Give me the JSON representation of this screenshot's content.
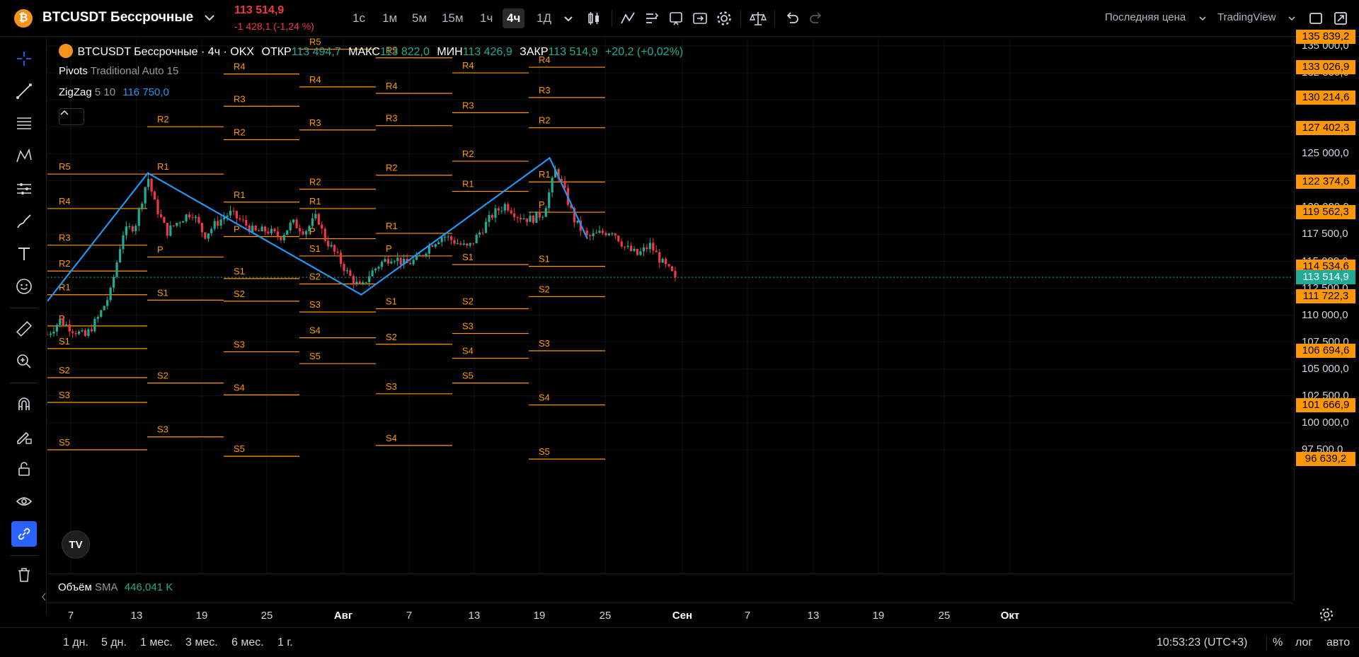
{
  "header": {
    "coin_glyph": "₿",
    "symbol": "BTCUSDT Бессрочные",
    "price": "113 514,9",
    "change": "-1 428,1 (-1,24 %)",
    "timeframes": [
      "1с",
      "1м",
      "5м",
      "15м",
      "1ч",
      "4ч",
      "1Д"
    ],
    "active_timeframe": "4ч",
    "price_type": "Последняя цена",
    "chart_source": "TradingView"
  },
  "legend": {
    "title": "BTCUSDT Бессрочные · 4ч · OKX",
    "open_label": "ОТКР",
    "open": "113 494,7",
    "high_label": "МАКС",
    "high": "113 822,0",
    "low_label": "МИН",
    "low": "113 426,9",
    "close_label": "ЗАКР",
    "close": "113 514,9",
    "change": "+20,2 (+0,02%)",
    "pivots_name": "Pivots",
    "pivots_params": "Traditional Auto 15",
    "zigzag_name": "ZigZag",
    "zigzag_params": "5 10",
    "zigzag_value": "116 750,0"
  },
  "volume": {
    "label": "Объём",
    "sma": "SMA",
    "value": "446,041 K"
  },
  "price_axis": {
    "ticks": [
      "135 000,0",
      "132 500,0",
      "130 000,0",
      "127 500,0",
      "125 000,0",
      "122 500,0",
      "120 000,0",
      "117 500,0",
      "115 000,0",
      "112 500,0",
      "110 000,0",
      "107 500,0",
      "105 000,0",
      "102 500,0",
      "100 000,0",
      "97 500,0"
    ],
    "labels": [
      "135 839,2",
      "133 026,9",
      "130 214,6",
      "127 402,3",
      "122 374,6",
      "119 562,3",
      "114 534,6",
      "111 722,3",
      "106 694,6",
      "101 666,9",
      "96 639,2"
    ],
    "current": "113 514,9"
  },
  "time_axis": [
    "7",
    "13",
    "19",
    "25",
    "Авг",
    "7",
    "13",
    "19",
    "25",
    "Сен",
    "7",
    "13",
    "19",
    "25",
    "Окт"
  ],
  "bottom": {
    "ranges": [
      "1 дн.",
      "5 дн.",
      "1 мес.",
      "3 мес.",
      "6 мес.",
      "1 г."
    ],
    "clock": "10:53:23 (UTC+3)",
    "percent": "%",
    "log": "лог",
    "auto": "авто"
  },
  "chart_data": {
    "type": "candlestick",
    "symbol": "BTCUSDT",
    "interval": "4h",
    "ylim": [
      95500,
      136500
    ],
    "x_ticks": [
      "7",
      "13",
      "19",
      "25",
      "Авг",
      "7",
      "13",
      "19",
      "25",
      "Сен",
      "7",
      "13",
      "19",
      "25",
      "Окт"
    ],
    "last_close": 113514.9,
    "price_path": [
      [
        0,
        108200
      ],
      [
        2,
        109500
      ],
      [
        4,
        108700
      ],
      [
        6,
        108000
      ],
      [
        8,
        109700
      ],
      [
        10,
        112000
      ],
      [
        12,
        117600
      ],
      [
        14,
        118400
      ],
      [
        16,
        122900
      ],
      [
        17,
        120500
      ],
      [
        19,
        117700
      ],
      [
        21,
        118800
      ],
      [
        23,
        119600
      ],
      [
        25,
        117400
      ],
      [
        27,
        118600
      ],
      [
        29,
        119500
      ],
      [
        31,
        118700
      ],
      [
        33,
        117700
      ],
      [
        35,
        117900
      ],
      [
        37,
        117200
      ],
      [
        39,
        118600
      ],
      [
        41,
        117800
      ],
      [
        43,
        119200
      ],
      [
        44,
        117300
      ],
      [
        46,
        115600
      ],
      [
        48,
        113700
      ],
      [
        50,
        112400
      ],
      [
        51,
        113600
      ],
      [
        53,
        114800
      ],
      [
        55,
        115500
      ],
      [
        57,
        114700
      ],
      [
        59,
        115200
      ],
      [
        61,
        116600
      ],
      [
        63,
        117400
      ],
      [
        65,
        116800
      ],
      [
        67,
        116200
      ],
      [
        69,
        117800
      ],
      [
        71,
        119400
      ],
      [
        73,
        120300
      ],
      [
        75,
        119200
      ],
      [
        77,
        118900
      ],
      [
        79,
        119500
      ],
      [
        81,
        123600
      ],
      [
        82,
        122100
      ],
      [
        84,
        118700
      ],
      [
        86,
        117200
      ],
      [
        88,
        117600
      ],
      [
        90,
        117900
      ],
      [
        92,
        116300
      ],
      [
        94,
        115600
      ],
      [
        96,
        116500
      ],
      [
        98,
        114800
      ],
      [
        100,
        113514.9
      ]
    ],
    "zigzag": [
      [
        0,
        111300
      ],
      [
        16,
        123200
      ],
      [
        50,
        111900
      ],
      [
        80,
        124600
      ],
      [
        86,
        117100
      ]
    ],
    "pivot_levels": [
      {
        "labels": [
          "R5",
          "R4",
          "R3",
          "R2",
          "R1",
          "P",
          "S1",
          "S2",
          "S3",
          "S5"
        ],
        "values": [
          123100,
          119900,
          116500,
          114100,
          111900,
          109000,
          106900,
          104200,
          101900,
          97500
        ]
      },
      {
        "labels": [
          "R2",
          "R1",
          "P",
          "S1",
          "S2",
          "S3"
        ],
        "values": [
          127500,
          123100,
          115400,
          111400,
          103700,
          98700
        ]
      },
      {
        "labels": [
          "R4",
          "R3",
          "R2",
          "R1",
          "P",
          "S1",
          "S2",
          "S3",
          "S4",
          "S5"
        ],
        "values": [
          132400,
          129400,
          126300,
          120500,
          117300,
          113400,
          111300,
          106600,
          102600,
          96900
        ]
      },
      {
        "labels": [
          "R5",
          "R4",
          "R3",
          "R2",
          "R1",
          "P",
          "S1",
          "S2",
          "S3",
          "S4",
          "S5"
        ],
        "values": [
          134700,
          131200,
          127200,
          121700,
          119900,
          117100,
          115500,
          112900,
          110300,
          107900,
          105500
        ]
      },
      {
        "labels": [
          "R5",
          "R4",
          "R3",
          "R2",
          "R1",
          "P",
          "S1",
          "S2",
          "S3",
          "S4"
        ],
        "values": [
          133900,
          130600,
          127600,
          123000,
          117600,
          115500,
          110600,
          107300,
          102700,
          97900
        ]
      },
      {
        "labels": [
          "R4",
          "R3",
          "R2",
          "R1",
          "S1",
          "S2",
          "S3",
          "S4",
          "S5"
        ],
        "values": [
          132500,
          128800,
          124300,
          121500,
          114700,
          110600,
          108300,
          106000,
          103700
        ]
      },
      {
        "labels": [
          "R4",
          "R3",
          "R2",
          "R1",
          "P",
          "S1",
          "S2",
          "S3",
          "S4",
          "S5"
        ],
        "values": [
          133026.9,
          130214.6,
          127402.3,
          122374.6,
          119562.3,
          114534.6,
          111722.3,
          106694.6,
          101666.9,
          96639.2
        ]
      }
    ]
  },
  "colors": {
    "up": "#22ab94",
    "down": "#f23645",
    "pivot": "#ff9800",
    "zigzag": "#2196f3",
    "accent": "#2962ff"
  }
}
